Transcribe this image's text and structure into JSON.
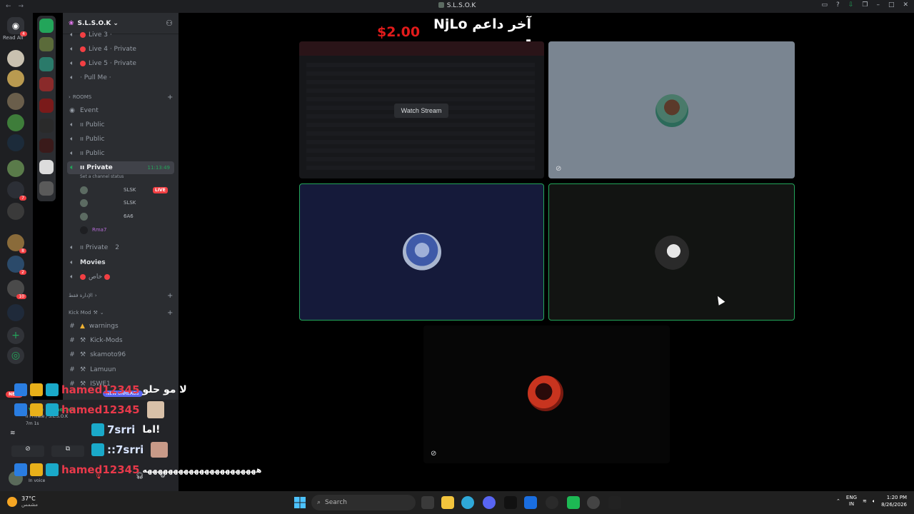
{
  "window": {
    "title": "S.L.S.O.K",
    "icon": "discord-icon"
  },
  "rail": {
    "dm_badge": "4",
    "read_all": "Read All",
    "badges": [
      "7",
      "8",
      "2",
      "10"
    ]
  },
  "server": {
    "name": "S.L.S.O.K",
    "channels_top": [
      {
        "name": "Live 3 ·",
        "icon": "speaker-icon",
        "dot": true
      },
      {
        "name": "Live 4 · Private",
        "icon": "speaker-icon",
        "dot": true
      },
      {
        "name": "Live 5 · Private",
        "icon": "speaker-icon",
        "dot": true
      },
      {
        "name": "· Pull Me ·",
        "icon": "speaker-icon",
        "dot": false
      }
    ],
    "rooms_category": "ROOMS",
    "rooms": [
      {
        "name": "Event",
        "icon": "stage-icon"
      },
      {
        "name": "ıı Public",
        "icon": "speaker-icon"
      },
      {
        "name": "ıı Public",
        "icon": "speaker-icon"
      },
      {
        "name": "ıı Public",
        "icon": "speaker-icon"
      }
    ],
    "active_channel": {
      "name": "ıı Private",
      "status": "Set a channel status",
      "time": "11:13:49"
    },
    "voice_users": [
      {
        "tag": "SLSK",
        "live": "LIVE"
      },
      {
        "tag": "SLSK",
        "live": ""
      },
      {
        "tag": "6A6",
        "live": ""
      },
      {
        "tag": "Rma7",
        "live": ""
      }
    ],
    "channels_after": [
      {
        "name": "ıı Private",
        "count": "2",
        "icon": "speaker-icon"
      },
      {
        "name": "Movies",
        "icon": "speaker-icon"
      },
      {
        "name": "خاص",
        "icon": "speaker-icon"
      }
    ],
    "admin_category": "الإدارة فقط",
    "kickmod_category": "Kick Mod",
    "text_channels": [
      {
        "name": "warnings",
        "icon": "warning-icon"
      },
      {
        "name": "Kick-Mods",
        "icon": "hammer-icon"
      },
      {
        "name": "skamoto96",
        "icon": "hammer-icon"
      },
      {
        "name": "Lamuun",
        "icon": "hammer-icon"
      },
      {
        "name": "ISWE1",
        "icon": "hammer-icon"
      }
    ],
    "new_unreads": "NEW UNREADS",
    "new_badge": "NEW"
  },
  "voice_panel": {
    "status": "Voice Connected",
    "channel": "ıı Private / S.L.S.O.K",
    "timer": "7m 1s",
    "in_voice": "In voice"
  },
  "stage": {
    "supporter_label": "آخر داعم NjLo -",
    "supporter_amount": "$2.00",
    "watch_stream": "Watch Stream"
  },
  "chat_overlay": [
    {
      "user": "hamed12345",
      "text": "لا مو حلو"
    },
    {
      "user": "hamed12345",
      "text": ""
    },
    {
      "user": "7srri",
      "text": "اما!"
    },
    {
      "user": "::7srri",
      "text": ""
    },
    {
      "user": "hamed12345",
      "text": "ههههههههههههههههههههههه"
    }
  ],
  "taskbar": {
    "temp": "37°C",
    "condition": "مشمس",
    "search_placeholder": "Search",
    "lang": "ENG",
    "lang_region": "IN",
    "time": "1:20 PM",
    "date": "8/26/2026"
  },
  "colors": {
    "online": "#23a55a",
    "live": "#f23f43",
    "supporter_amount": "#e21b1b",
    "username": "#e8394a"
  }
}
